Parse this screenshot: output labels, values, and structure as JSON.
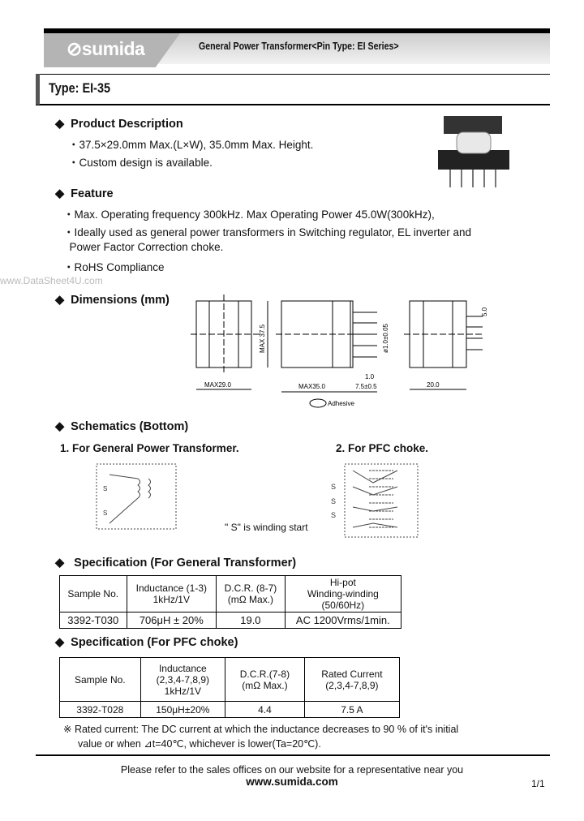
{
  "header": {
    "logo": "sumida",
    "title": "General Power Transformer<Pin Type: EI Series>"
  },
  "type_title": "Type: EI-35",
  "watermark": "www.DataSheet4U.com",
  "product_description": {
    "heading": "Product Description",
    "items": [
      "・37.5×29.0mm Max.(L×W), 35.0mm Max. Height.",
      "・Custom design is available."
    ]
  },
  "feature": {
    "heading": "Feature",
    "items": [
      "・Max. Operating frequency 300kHz. Max Operating Power 45.0W(300kHz),",
      "・Ideally used as general power transformers in Switching regulator, EL inverter and",
      "  Power Factor Correction choke.",
      "・RoHS Compliance"
    ]
  },
  "dimensions": {
    "heading": "Dimensions (mm)",
    "labels": {
      "width": "MAX29.0",
      "length": "MAX35.0",
      "height": "MAX 37.5",
      "pin_len": "7.5±0.5",
      "depth": "20.0",
      "pin_pitch": "5.0",
      "pin_dia": "ø1.0±0.05",
      "pin_gap": "1.0",
      "adhesive": "Adhesive"
    }
  },
  "schematics": {
    "heading": "Schematics (Bottom)",
    "sub1": "1. For General Power Transformer.",
    "sub2": "2. For PFC choke.",
    "note": "\" S\" is winding start",
    "s": "S"
  },
  "spec_general": {
    "heading": "Specification (For General Transformer)",
    "headers": [
      "Sample No.",
      "Inductance (1-3)\n1kHz/1V",
      "D.C.R. (8-7)\n(mΩ  Max.)",
      "Hi-pot\nWinding-winding\n(50/60Hz)"
    ],
    "row": [
      "3392-T030",
      "706μH ± 20%",
      "19.0",
      "AC 1200Vrms/1min."
    ]
  },
  "spec_pfc": {
    "heading": "Specification (For PFC choke)",
    "headers": [
      "Sample No.",
      "Inductance\n(2,3,4-7,8,9)\n1kHz/1V",
      "D.C.R.(7-8)\n(mΩ  Max.)",
      "Rated Current\n(2,3,4-7,8,9)"
    ],
    "row": [
      "3392-T028",
      "150μH±20%",
      "4.4",
      "7.5 A"
    ]
  },
  "note": [
    "※ Rated current: The DC current at which the inductance decreases to 90 % of it's initial",
    "value or when  ⊿t=40℃, whichever is lower(Ta=20℃)."
  ],
  "footer": {
    "text": "Please refer to the sales offices on our website for a representative near you",
    "url": "www.sumida.com",
    "page": "1/1"
  }
}
